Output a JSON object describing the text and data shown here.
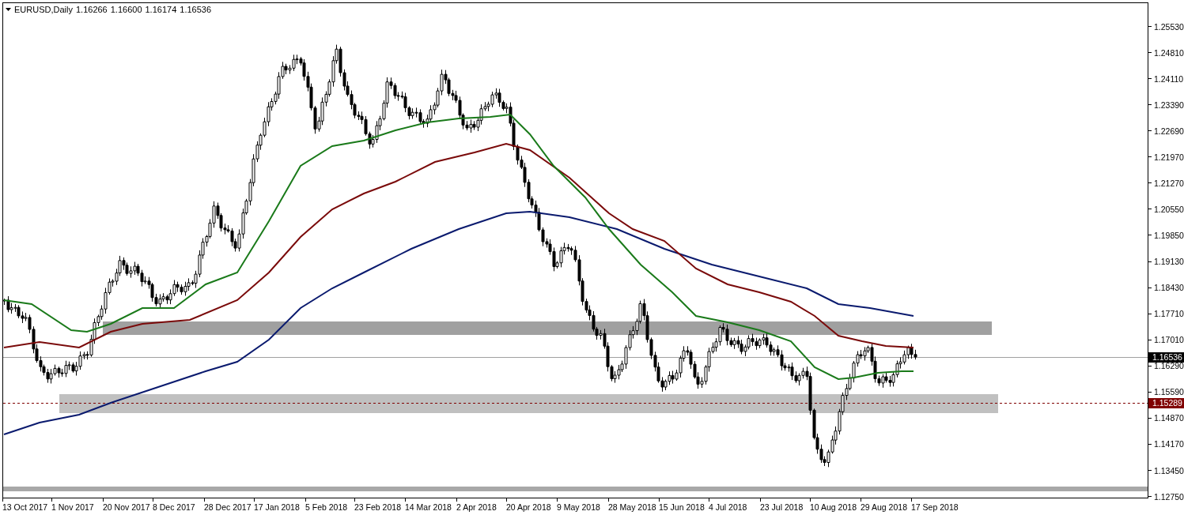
{
  "chart": {
    "symbol": "EURUSD,Daily",
    "ohlc": [
      "1.16266",
      "1.16600",
      "1.16174",
      "1.16536"
    ],
    "price_axis": [
      "1.25530",
      "1.24810",
      "1.24110",
      "1.23390",
      "1.22690",
      "1.21970",
      "1.21270",
      "1.20550",
      "1.19850",
      "1.19130",
      "1.18430",
      "1.17710",
      "1.17010",
      "1.16290",
      "1.15590",
      "1.14870",
      "1.14170",
      "1.13450",
      "1.12750"
    ],
    "bid_label": "1.16536",
    "level_label": "1.15289",
    "time_axis": [
      "13 Oct 2017",
      "1 Nov 2017",
      "20 Nov 2017",
      "8 Dec 2017",
      "28 Dec 2017",
      "17 Jan 2018",
      "5 Feb 2018",
      "23 Feb 2018",
      "14 Mar 2018",
      "2 Apr 2018",
      "20 Apr 2018",
      "9 May 2018",
      "28 May 2018",
      "15 Jun 2018",
      "4 Jul 2018",
      "23 Jul 2018",
      "10 Aug 2018",
      "29 Aug 2018",
      "17 Sep 2018"
    ]
  }
}
